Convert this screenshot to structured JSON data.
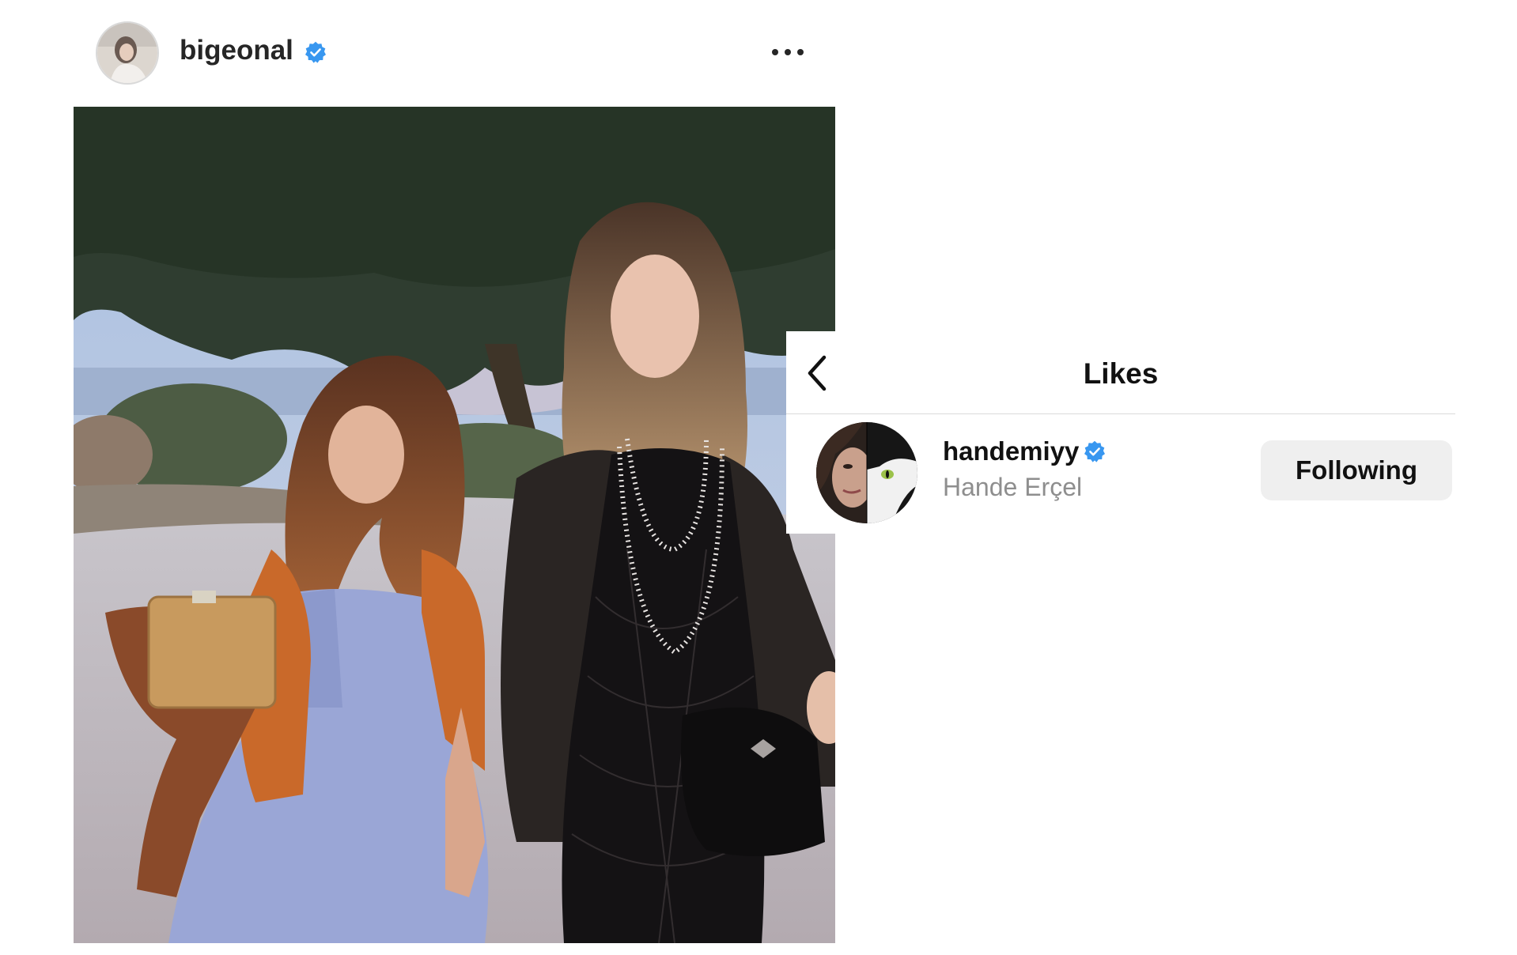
{
  "post": {
    "author_username": "bigeonal",
    "author_verified": true,
    "more_icon": "more-horizontal-icon"
  },
  "likes_panel": {
    "title": "Likes",
    "back_icon": "chevron-left-icon",
    "users": [
      {
        "username": "handemiyy",
        "verified": true,
        "full_name": "Hande Erçel",
        "button_label": "Following"
      }
    ]
  },
  "colors": {
    "verified_badge": "#3897f0",
    "following_button_bg": "#efefef",
    "secondary_text": "#8e8e8e"
  }
}
